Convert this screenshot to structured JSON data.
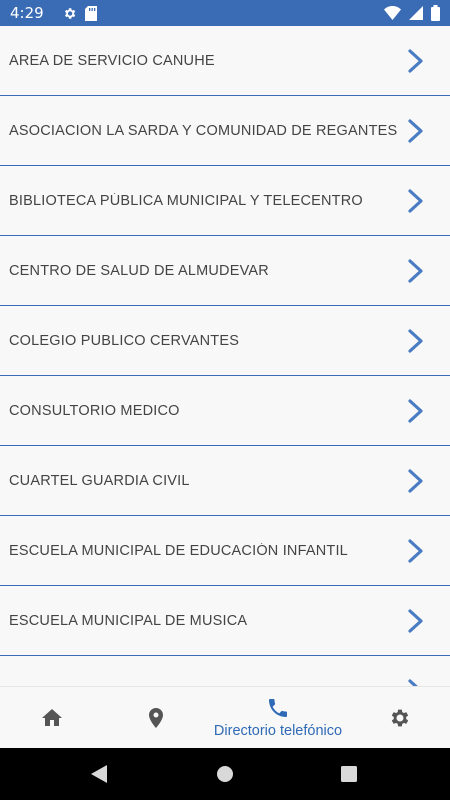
{
  "status_bar": {
    "time": "4:29",
    "icons": [
      "gear-icon",
      "sd-card-icon",
      "wifi-icon",
      "signal-icon",
      "battery-icon"
    ]
  },
  "directory": {
    "items": [
      {
        "label": "AREA DE SERVICIO CANUHE"
      },
      {
        "label": "ASOCIACION LA SARDA Y COMUNIDAD DE REGANTES"
      },
      {
        "label": "BIBLIOTECA PÚBLICA MUNICIPAL Y TELECENTRO"
      },
      {
        "label": "CENTRO DE SALUD DE ALMUDEVAR"
      },
      {
        "label": "COLEGIO PUBLICO CERVANTES"
      },
      {
        "label": "CONSULTORIO MEDICO"
      },
      {
        "label": "CUARTEL GUARDIA CIVIL"
      },
      {
        "label": "ESCUELA MUNICIPAL DE EDUCACIÓN INFANTIL"
      },
      {
        "label": "ESCUELA MUNICIPAL DE MUSICA"
      }
    ]
  },
  "bottom_nav": {
    "active_label": "Directorio telefónico",
    "items": [
      "home-icon",
      "location-pin-icon",
      "phone-icon",
      "gear-icon"
    ]
  },
  "colors": {
    "accent": "#3a6cb5",
    "chevron": "#4a7cc4",
    "text": "#444444",
    "background": "#f8f8f8"
  }
}
